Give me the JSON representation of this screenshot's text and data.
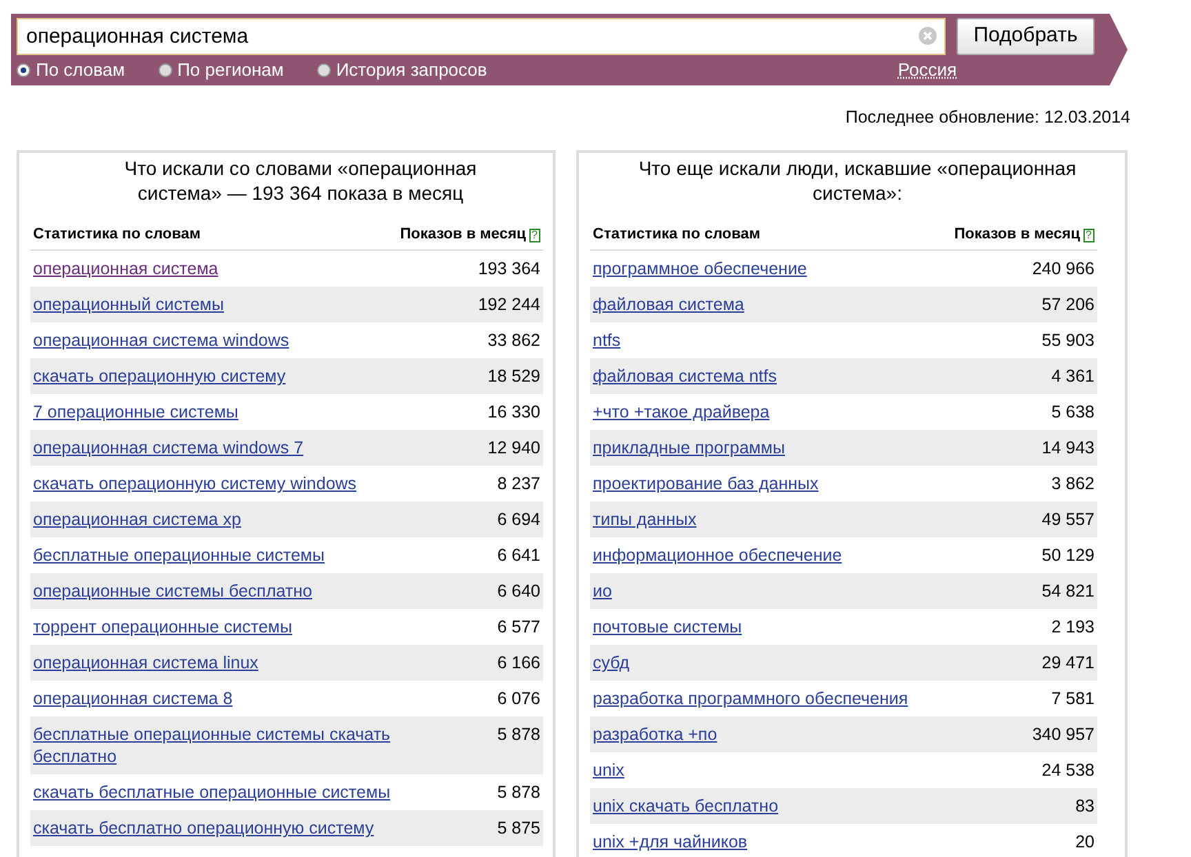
{
  "search": {
    "value": "операционная система",
    "button": "Подобрать",
    "modes": [
      {
        "label": "По словам",
        "selected": true
      },
      {
        "label": "По регионам",
        "selected": false
      },
      {
        "label": "История запросов",
        "selected": false
      }
    ],
    "region": "Россия"
  },
  "last_update": "Последнее обновление: 12.03.2014",
  "panels": [
    {
      "title": "Что искали со словами «операционная система» — 193 364 показа в месяц",
      "columns": [
        "Статистика по словам",
        "Показов в месяц"
      ],
      "help": "?",
      "rows": [
        {
          "keyword": "операционная система",
          "count": "193 364",
          "visited": true
        },
        {
          "keyword": "операционный системы",
          "count": "192 244",
          "visited": false
        },
        {
          "keyword": "операционная система windows",
          "count": "33 862",
          "visited": false
        },
        {
          "keyword": "скачать операционную систему",
          "count": "18 529",
          "visited": false
        },
        {
          "keyword": "7 операционные системы",
          "count": "16 330",
          "visited": false
        },
        {
          "keyword": "операционная система windows 7",
          "count": "12 940",
          "visited": false
        },
        {
          "keyword": "скачать операционную систему windows",
          "count": "8 237",
          "visited": false
        },
        {
          "keyword": "операционная система xp",
          "count": "6 694",
          "visited": false
        },
        {
          "keyword": "бесплатные операционные системы",
          "count": "6 641",
          "visited": false
        },
        {
          "keyword": "операционные системы бесплатно",
          "count": "6 640",
          "visited": false
        },
        {
          "keyword": "торрент операционные системы",
          "count": "6 577",
          "visited": false
        },
        {
          "keyword": "операционная система linux",
          "count": "6 166",
          "visited": false
        },
        {
          "keyword": "операционная система 8",
          "count": "6 076",
          "visited": false
        },
        {
          "keyword": "бесплатные операционные системы скачать бесплатно",
          "count": "5 878",
          "visited": false
        },
        {
          "keyword": "скачать бесплатные операционные системы",
          "count": "5 878",
          "visited": false
        },
        {
          "keyword": "скачать бесплатно операционную систему",
          "count": "5 875",
          "visited": false
        }
      ]
    },
    {
      "title": "Что еще искали люди, искавшие «операционная система»:",
      "columns": [
        "Статистика по словам",
        "Показов в месяц"
      ],
      "help": "?",
      "rows": [
        {
          "keyword": "программное обеспечение",
          "count": "240 966",
          "visited": false
        },
        {
          "keyword": "файловая система",
          "count": "57 206",
          "visited": false
        },
        {
          "keyword": "ntfs",
          "count": "55 903",
          "visited": false
        },
        {
          "keyword": "файловая система ntfs",
          "count": "4 361",
          "visited": false
        },
        {
          "keyword": "+что +такое драйвера",
          "count": "5 638",
          "visited": false
        },
        {
          "keyword": "прикладные программы",
          "count": "14 943",
          "visited": false
        },
        {
          "keyword": "проектирование баз данных",
          "count": "3 862",
          "visited": false
        },
        {
          "keyword": "типы данных",
          "count": "49 557",
          "visited": false
        },
        {
          "keyword": "информационное обеспечение",
          "count": "50 129",
          "visited": false
        },
        {
          "keyword": "ио",
          "count": "54 821",
          "visited": false
        },
        {
          "keyword": "почтовые системы",
          "count": "2 193",
          "visited": false
        },
        {
          "keyword": "субд",
          "count": "29 471",
          "visited": false
        },
        {
          "keyword": "разработка программного обеспечения",
          "count": "7 581",
          "visited": false
        },
        {
          "keyword": "разработка +по",
          "count": "340 957",
          "visited": false
        },
        {
          "keyword": "unix",
          "count": "24 538",
          "visited": false
        },
        {
          "keyword": "unix скачать бесплатно",
          "count": "83",
          "visited": false
        },
        {
          "keyword": "unix +для чайников",
          "count": "20",
          "visited": false
        }
      ]
    }
  ]
}
